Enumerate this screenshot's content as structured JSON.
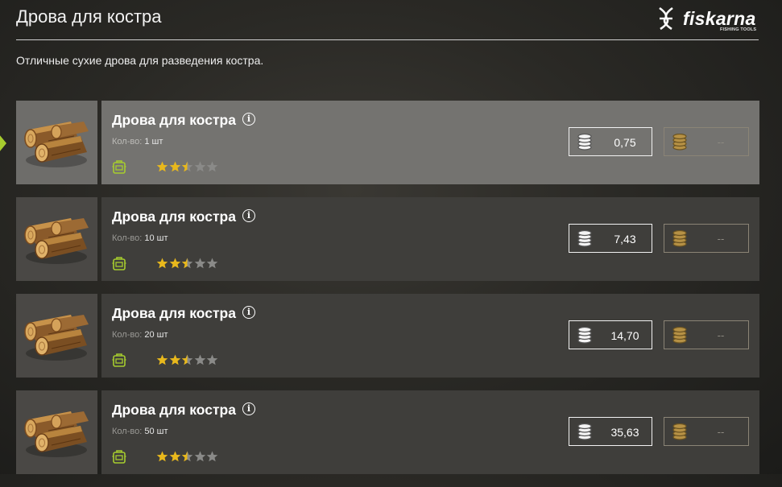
{
  "header": {
    "title": "Дрова для костра"
  },
  "logo": {
    "text": "fiskarna",
    "subtitle": "FISHING TOOLS"
  },
  "description": "Отличные сухие дрова для разведения костра.",
  "items": [
    {
      "name": "Дрова для костра",
      "qty_label": "Кол-во:",
      "qty_value": "1 шт",
      "silver_price": "0,75",
      "gold_price": "--",
      "rating": 2.5,
      "selected": true
    },
    {
      "name": "Дрова для костра",
      "qty_label": "Кол-во:",
      "qty_value": "10 шт",
      "silver_price": "7,43",
      "gold_price": "--",
      "rating": 2.5,
      "selected": false
    },
    {
      "name": "Дрова для костра",
      "qty_label": "Кол-во:",
      "qty_value": "20 шт",
      "silver_price": "14,70",
      "gold_price": "--",
      "rating": 2.5,
      "selected": false
    },
    {
      "name": "Дрова для костра",
      "qty_label": "Кол-во:",
      "qty_value": "50 шт",
      "silver_price": "35,63",
      "gold_price": "--",
      "rating": 2.5,
      "selected": false
    }
  ],
  "colors": {
    "accent": "#a6cc2e",
    "star_filled": "#e8b81c",
    "star_empty": "#8a8a88",
    "gold_coin": "#b69145"
  }
}
